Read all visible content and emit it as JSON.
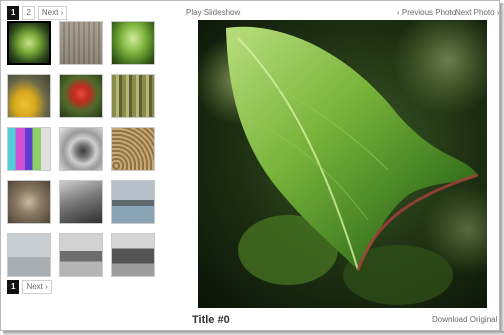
{
  "pagination_top": {
    "pages": [
      "1",
      "2"
    ],
    "active": "1",
    "next": "Next ›"
  },
  "pagination_bottom": {
    "pages": [
      "1"
    ],
    "active": "1",
    "next": "Next ›"
  },
  "controls": {
    "slideshow": "Play Slideshow",
    "previous": "‹ Previous Photo",
    "next": "Next Photo ›"
  },
  "photo": {
    "title": "Title #0",
    "download": "Download Original"
  },
  "thumbnails": [
    {
      "name": "thumb-leaf",
      "selected": true
    },
    {
      "name": "thumb-circuit",
      "selected": false
    },
    {
      "name": "thumb-green-leaf",
      "selected": false
    },
    {
      "name": "thumb-yellow-fruit",
      "selected": false
    },
    {
      "name": "thumb-red-flower",
      "selected": false
    },
    {
      "name": "thumb-bamboo",
      "selected": false
    },
    {
      "name": "thumb-color-stripes",
      "selected": false
    },
    {
      "name": "thumb-camera-lens",
      "selected": false
    },
    {
      "name": "thumb-spiral",
      "selected": false
    },
    {
      "name": "thumb-rope",
      "selected": false
    },
    {
      "name": "thumb-night-road",
      "selected": false
    },
    {
      "name": "thumb-coast",
      "selected": false
    },
    {
      "name": "thumb-sea",
      "selected": false
    },
    {
      "name": "thumb-rocks-coast",
      "selected": false
    },
    {
      "name": "thumb-cliffs",
      "selected": false
    }
  ]
}
